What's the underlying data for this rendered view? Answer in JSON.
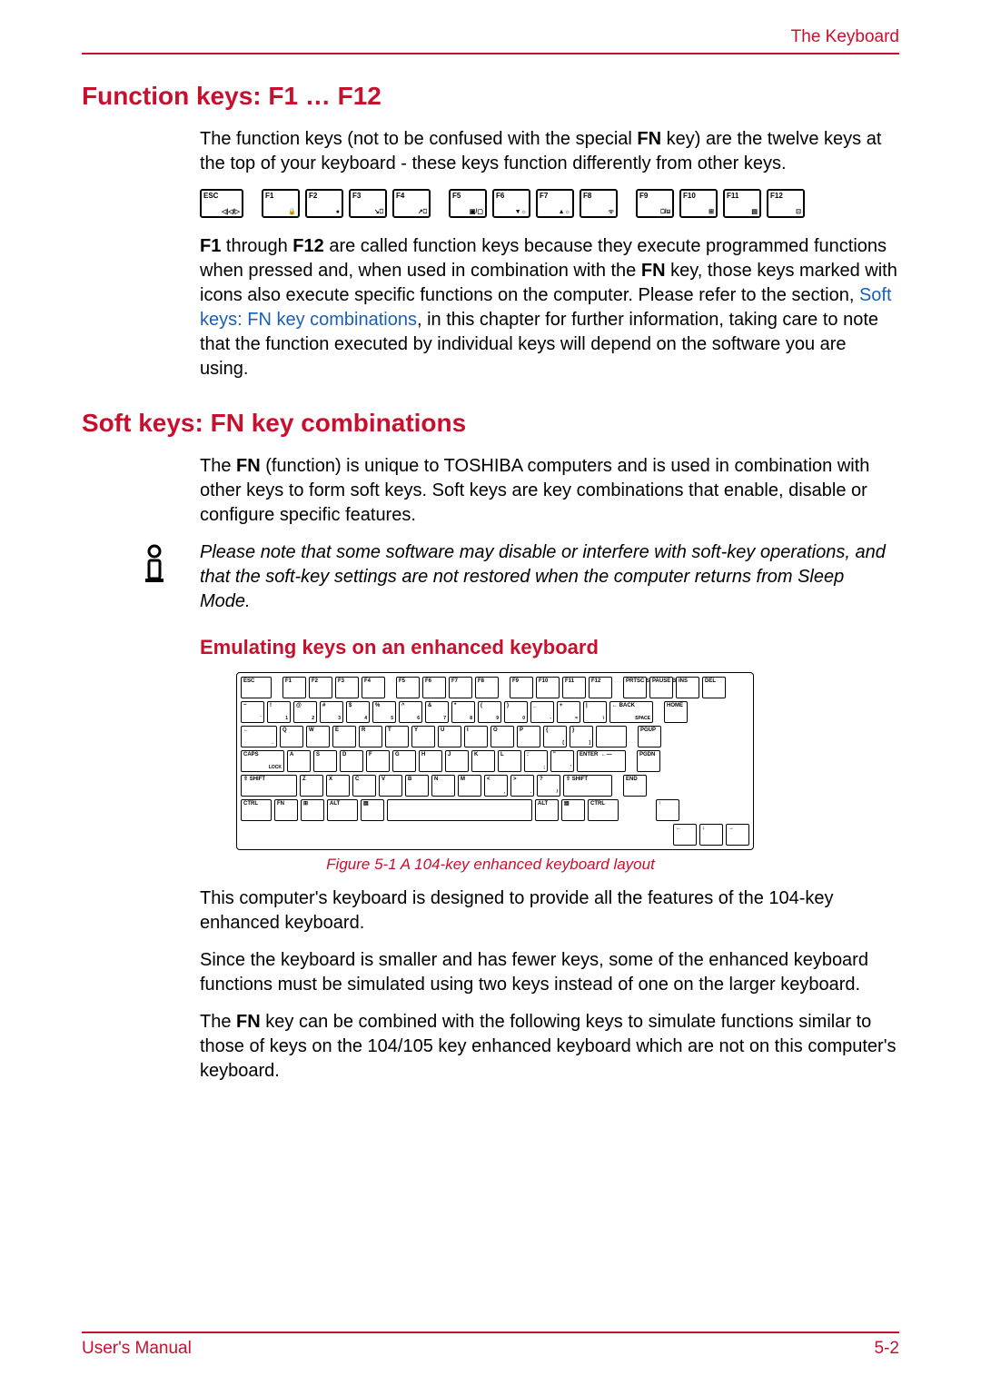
{
  "header": {
    "right_title": "The Keyboard"
  },
  "section1": {
    "heading": "Function keys: F1 … F12",
    "para1_pre": "The function keys (not to be confused with the special ",
    "para1_bold": "FN",
    "para1_post": " key) are the twelve keys at the top of your keyboard - these keys function differently from other keys.",
    "fkeys": [
      {
        "label": "ESC",
        "sub": "◁|◁/▷"
      },
      {
        "label": "F1",
        "sub": "🔒"
      },
      {
        "label": "F2",
        "sub": "●"
      },
      {
        "label": "F3",
        "sub": "↘⎕"
      },
      {
        "label": "F4",
        "sub": "↗⎕"
      },
      {
        "label": "F5",
        "sub": "▣/▢"
      },
      {
        "label": "F6",
        "sub": "▼☼"
      },
      {
        "label": "F7",
        "sub": "▲☼"
      },
      {
        "label": "F8",
        "sub": "ᯤ"
      },
      {
        "label": "F9",
        "sub": "⎕/⊟"
      },
      {
        "label": "F10",
        "sub": "⊞"
      },
      {
        "label": "F11",
        "sub": "▤"
      },
      {
        "label": "F12",
        "sub": "⊡"
      }
    ],
    "para2_a": "F1",
    "para2_b": " through ",
    "para2_c": "F12",
    "para2_d": " are called function keys because they execute programmed functions when pressed and, when used in combination with the ",
    "para2_e": "FN",
    "para2_f": " key, those keys marked with icons also execute specific functions on the computer. Please refer to the section, ",
    "para2_link": "Soft keys: FN key combinations",
    "para2_g": ", in this chapter for further information, taking care to note that the function executed by individual keys will depend on the software you are using."
  },
  "section2": {
    "heading": "Soft keys: FN key combinations",
    "para1_a": "The ",
    "para1_b": "FN",
    "para1_c": " (function) is unique to TOSHIBA computers and is used in combination with other keys to form soft keys. Soft keys are key combinations that enable, disable or configure specific features.",
    "note": "Please note that some software may disable or interfere with soft-key operations, and that the soft-key settings are not restored when the computer returns from Sleep Mode.",
    "subheading": "Emulating keys on an enhanced keyboard",
    "keyboard": {
      "row0": [
        "ESC",
        "F1",
        "F2",
        "F3",
        "F4",
        "F5",
        "F6",
        "F7",
        "F8",
        "F9",
        "F10",
        "F11",
        "F12",
        "",
        "PRTSC SYSRQ",
        "PAUSE BREAK",
        "INS",
        "DEL"
      ],
      "row1": [
        [
          "~",
          "`"
        ],
        [
          "!",
          "1"
        ],
        [
          "@",
          "2"
        ],
        [
          "#",
          "3"
        ],
        [
          "$",
          "4"
        ],
        [
          "%",
          "5"
        ],
        [
          "^",
          "6"
        ],
        [
          "&",
          "7"
        ],
        [
          "*",
          "8"
        ],
        [
          "(",
          "9"
        ],
        [
          ")",
          "0"
        ],
        [
          "_",
          "-"
        ],
        [
          "+",
          "="
        ],
        [
          "|",
          "\\"
        ],
        [
          "← BACK",
          "SPACE"
        ],
        "",
        "HOME"
      ],
      "row2": [
        [
          "←",
          "→"
        ],
        "Q",
        "W",
        "E",
        "R",
        "T",
        "Y",
        "U",
        "I",
        "O",
        "P",
        [
          "{",
          "["
        ],
        [
          "}",
          "]"
        ],
        "",
        "",
        "",
        "PGUP"
      ],
      "row3": [
        [
          "CAPS",
          "LOCK"
        ],
        "A",
        "S",
        "D",
        "F",
        "G",
        "H",
        "J",
        "K",
        "L",
        [
          ":",
          ";"
        ],
        [
          "\"",
          "'"
        ],
        "ENTER  ←—",
        "",
        "PGDN"
      ],
      "row4": [
        "⇧ SHIFT",
        "Z",
        "X",
        "C",
        "V",
        "B",
        "N",
        "M",
        [
          "<",
          ","
        ],
        [
          ">",
          "."
        ],
        [
          "?",
          "/"
        ],
        "⇧ SHIFT",
        "",
        "END"
      ],
      "row5": [
        "CTRL",
        "FN",
        "⊞",
        "ALT",
        "▤",
        "",
        "ALT",
        "▤",
        "CTRL",
        "",
        "↑",
        ""
      ],
      "row6": [
        "",
        "",
        "",
        "",
        "",
        "",
        "",
        "",
        "",
        "←",
        "↓",
        "→"
      ]
    },
    "figure_caption": "Figure 5-1 A 104-key enhanced keyboard layout",
    "para3": "This computer's keyboard is designed to provide all the features of the 104-key enhanced keyboard.",
    "para4": "Since the keyboard is smaller and has fewer keys, some of the enhanced keyboard functions must be simulated using two keys instead of one on the larger keyboard.",
    "para5_a": "The ",
    "para5_b": "FN",
    "para5_c": " key can be combined with the following keys to simulate functions similar to those of keys on the 104/105 key enhanced keyboard which are not on this computer's keyboard."
  },
  "footer": {
    "left": "User's Manual",
    "right": "5-2"
  }
}
